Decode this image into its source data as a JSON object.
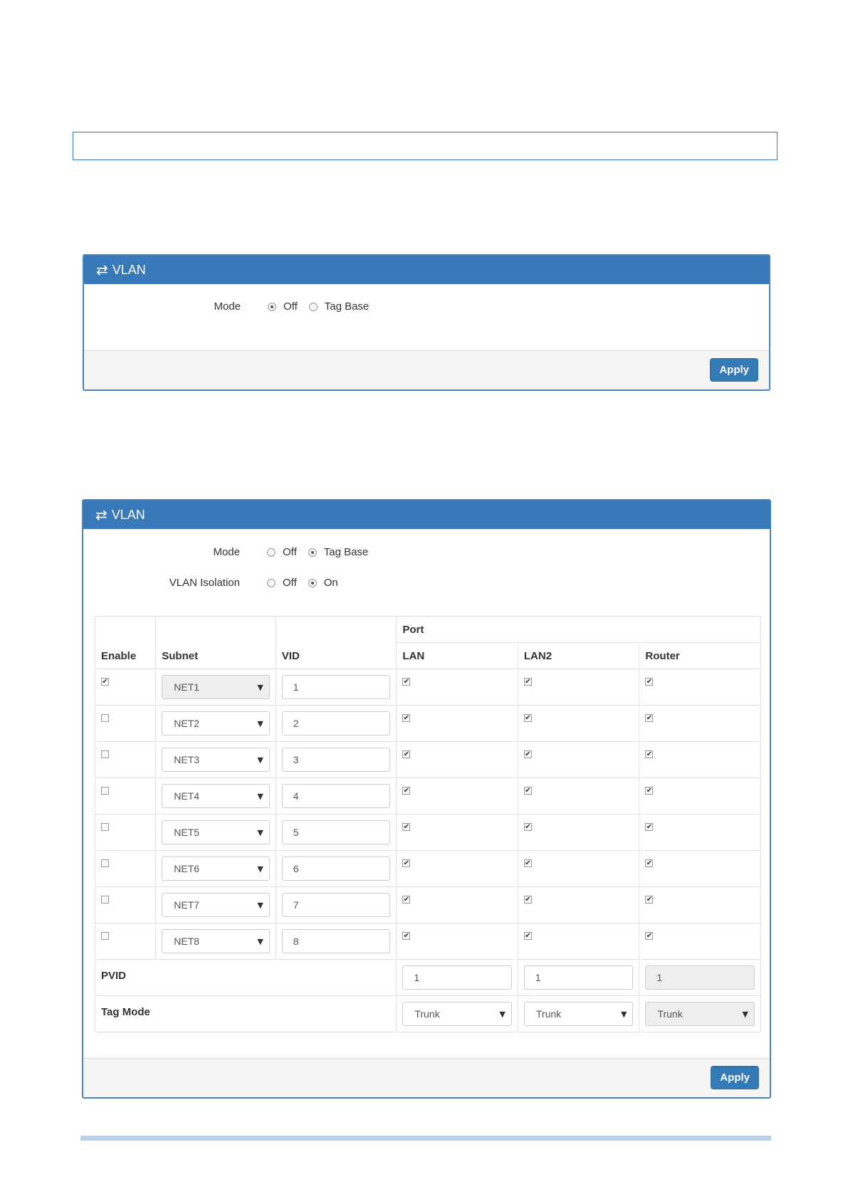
{
  "panel1": {
    "title": "VLAN",
    "mode_label": "Mode",
    "mode_options": [
      "Off",
      "Tag Base"
    ],
    "mode_selected": "Off",
    "apply_label": "Apply"
  },
  "panel2": {
    "title": "VLAN",
    "mode_label": "Mode",
    "mode_options": [
      "Off",
      "Tag Base"
    ],
    "mode_selected": "Tag Base",
    "isolation_label": "VLAN Isolation",
    "isolation_options": [
      "Off",
      "On"
    ],
    "isolation_selected": "On",
    "table": {
      "headers": {
        "enable": "Enable",
        "subnet": "Subnet",
        "vid": "VID",
        "port": "Port",
        "lan": "LAN",
        "lan2": "LAN2",
        "router": "Router"
      },
      "rows": [
        {
          "enable": true,
          "subnet": "NET1",
          "vid": "1",
          "lan": true,
          "lan2": true,
          "router": true
        },
        {
          "enable": false,
          "subnet": "NET2",
          "vid": "2",
          "lan": true,
          "lan2": true,
          "router": true
        },
        {
          "enable": false,
          "subnet": "NET3",
          "vid": "3",
          "lan": true,
          "lan2": true,
          "router": true
        },
        {
          "enable": false,
          "subnet": "NET4",
          "vid": "4",
          "lan": true,
          "lan2": true,
          "router": true
        },
        {
          "enable": false,
          "subnet": "NET5",
          "vid": "5",
          "lan": true,
          "lan2": true,
          "router": true
        },
        {
          "enable": false,
          "subnet": "NET6",
          "vid": "6",
          "lan": true,
          "lan2": true,
          "router": true
        },
        {
          "enable": false,
          "subnet": "NET7",
          "vid": "7",
          "lan": true,
          "lan2": true,
          "router": true
        },
        {
          "enable": false,
          "subnet": "NET8",
          "vid": "8",
          "lan": true,
          "lan2": true,
          "router": true
        }
      ],
      "pvid_label": "PVID",
      "pvid": {
        "lan": "1",
        "lan2": "1",
        "router": "1"
      },
      "tagmode_label": "Tag Mode",
      "tagmode": {
        "lan": "Trunk",
        "lan2": "Trunk",
        "router": "Trunk"
      }
    },
    "apply_label": "Apply"
  },
  "icons": {
    "header": "exchange-arrows-icon",
    "dropdown": "caret-down-icon",
    "check": "check-icon"
  },
  "colors": {
    "header_bg": "#3779b9",
    "button_bg": "#337ab7",
    "footer_bg": "#f5f5f5"
  }
}
